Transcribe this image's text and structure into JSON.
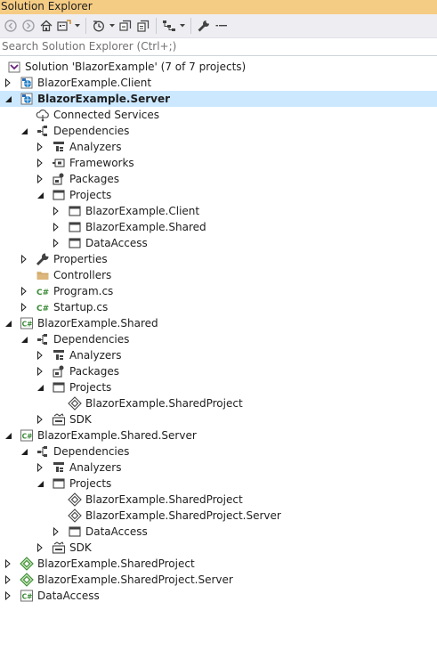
{
  "window": {
    "title": "Solution Explorer"
  },
  "search": {
    "placeholder": "Search Solution Explorer (Ctrl+;)"
  },
  "toolbar": {
    "buttons": [
      "back-icon",
      "forward-icon",
      "home-icon",
      "switch-views-icon",
      "chevron-down-icon",
      "pending-changes-icon",
      "chevron-down-icon",
      "collapse-all-icon",
      "show-all-files-icon",
      "sync-icon",
      "chevron-down-icon",
      "properties-wrench-icon",
      "preview-icon"
    ]
  },
  "tree": [
    {
      "label": "Solution 'BlazorExample' (7 of 7 projects)",
      "depth": 0,
      "state": "none",
      "icon": "solution-icon"
    },
    {
      "label": "BlazorExample.Client",
      "depth": 0,
      "state": "collapsed",
      "icon": "web-project-icon"
    },
    {
      "label": "BlazorExample.Server",
      "depth": 0,
      "state": "expanded",
      "icon": "web-project-icon",
      "selected": true
    },
    {
      "label": "Connected Services",
      "depth": 1,
      "state": "none",
      "icon": "connected-services-icon"
    },
    {
      "label": "Dependencies",
      "depth": 1,
      "state": "expanded",
      "icon": "dependencies-icon"
    },
    {
      "label": "Analyzers",
      "depth": 2,
      "state": "collapsed",
      "icon": "analyzers-icon"
    },
    {
      "label": "Frameworks",
      "depth": 2,
      "state": "collapsed",
      "icon": "frameworks-icon"
    },
    {
      "label": "Packages",
      "depth": 2,
      "state": "collapsed",
      "icon": "packages-icon"
    },
    {
      "label": "Projects",
      "depth": 2,
      "state": "expanded",
      "icon": "projects-icon"
    },
    {
      "label": "BlazorExample.Client",
      "depth": 3,
      "state": "collapsed",
      "icon": "project-ref-icon"
    },
    {
      "label": "BlazorExample.Shared",
      "depth": 3,
      "state": "collapsed",
      "icon": "project-ref-icon"
    },
    {
      "label": "DataAccess",
      "depth": 3,
      "state": "collapsed",
      "icon": "project-ref-icon"
    },
    {
      "label": "Properties",
      "depth": 1,
      "state": "collapsed",
      "icon": "wrench-icon"
    },
    {
      "label": "Controllers",
      "depth": 1,
      "state": "none",
      "icon": "folder-icon"
    },
    {
      "label": "Program.cs",
      "depth": 1,
      "state": "collapsed",
      "icon": "csharp-file-icon"
    },
    {
      "label": "Startup.cs",
      "depth": 1,
      "state": "collapsed",
      "icon": "csharp-file-icon"
    },
    {
      "label": "BlazorExample.Shared",
      "depth": 0,
      "state": "expanded",
      "icon": "csharp-project-icon"
    },
    {
      "label": "Dependencies",
      "depth": 1,
      "state": "expanded",
      "icon": "dependencies-icon"
    },
    {
      "label": "Analyzers",
      "depth": 2,
      "state": "collapsed",
      "icon": "analyzers-icon"
    },
    {
      "label": "Packages",
      "depth": 2,
      "state": "collapsed",
      "icon": "packages-icon"
    },
    {
      "label": "Projects",
      "depth": 2,
      "state": "expanded",
      "icon": "projects-icon"
    },
    {
      "label": "BlazorExample.SharedProject",
      "depth": 3,
      "state": "none",
      "icon": "shared-project-ref-icon"
    },
    {
      "label": "SDK",
      "depth": 2,
      "state": "collapsed",
      "icon": "sdk-icon"
    },
    {
      "label": "BlazorExample.Shared.Server",
      "depth": 0,
      "state": "expanded",
      "icon": "csharp-project-icon"
    },
    {
      "label": "Dependencies",
      "depth": 1,
      "state": "expanded",
      "icon": "dependencies-icon"
    },
    {
      "label": "Analyzers",
      "depth": 2,
      "state": "collapsed",
      "icon": "analyzers-icon"
    },
    {
      "label": "Projects",
      "depth": 2,
      "state": "expanded",
      "icon": "projects-icon"
    },
    {
      "label": "BlazorExample.SharedProject",
      "depth": 3,
      "state": "none",
      "icon": "shared-project-ref-icon"
    },
    {
      "label": "BlazorExample.SharedProject.Server",
      "depth": 3,
      "state": "none",
      "icon": "shared-project-ref-icon"
    },
    {
      "label": "DataAccess",
      "depth": 3,
      "state": "collapsed",
      "icon": "project-ref-icon"
    },
    {
      "label": "SDK",
      "depth": 2,
      "state": "collapsed",
      "icon": "sdk-icon"
    },
    {
      "label": "BlazorExample.SharedProject",
      "depth": 0,
      "state": "collapsed",
      "icon": "shared-project-icon"
    },
    {
      "label": "BlazorExample.SharedProject.Server",
      "depth": 0,
      "state": "collapsed",
      "icon": "shared-project-icon"
    },
    {
      "label": "DataAccess",
      "depth": 0,
      "state": "collapsed",
      "icon": "csharp-project-icon"
    }
  ],
  "colors": {
    "title_bg": "#f5cc84",
    "toolbar_bg": "#eeeef2",
    "selection": "#cce8ff",
    "csharp_green": "#388a34",
    "web_blue": "#1e7ec8"
  }
}
